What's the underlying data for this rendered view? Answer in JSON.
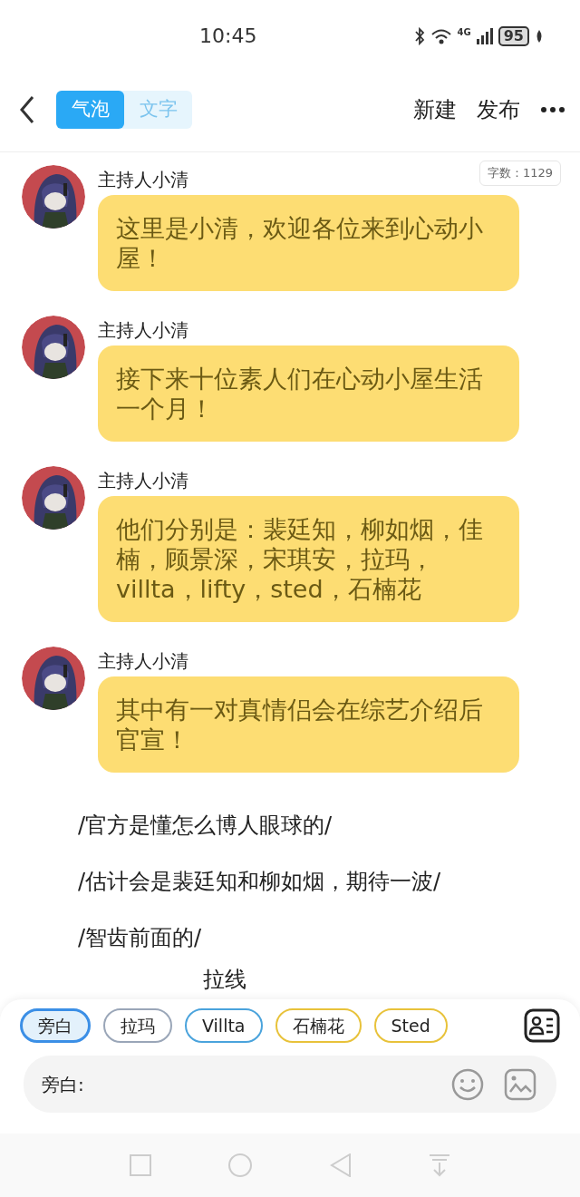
{
  "status_bar": {
    "time": "10:45",
    "network": "4G",
    "battery": "95"
  },
  "header": {
    "modes": [
      {
        "label": "气泡",
        "selected": true
      },
      {
        "label": "文字",
        "selected": false
      }
    ],
    "actions": [
      "新建",
      "发布"
    ]
  },
  "word_count": "字数：1129",
  "messages": [
    {
      "kind": "bubble",
      "speaker": "主持人小清",
      "text": "这里是小清，欢迎各位来到心动小屋！"
    },
    {
      "kind": "bubble",
      "speaker": "主持人小清",
      "text": "接下来十位素人们在心动小屋生活一个月！"
    },
    {
      "kind": "bubble",
      "speaker": "主持人小清",
      "text": "他们分别是：裴廷知，柳如烟，佳楠，顾景深，宋琪安，拉玛，villta，lifty，sted，石楠花"
    },
    {
      "kind": "bubble",
      "speaker": "主持人小清",
      "text": "其中有一对真情侣会在综艺介绍后官宣！"
    },
    {
      "kind": "narration",
      "text": "/官方是懂怎么博人眼球的/"
    },
    {
      "kind": "narration",
      "text": "/估计会是裴廷知和柳如烟，期待一波/"
    },
    {
      "kind": "narration",
      "text": "/智齿前面的/"
    },
    {
      "kind": "centered",
      "text": "拉线"
    }
  ],
  "roles": [
    {
      "label": "旁白",
      "selected": true,
      "color": "#3b8fe6"
    },
    {
      "label": "拉玛",
      "selected": false,
      "color": "#9aa6b8"
    },
    {
      "label": "Villta",
      "selected": false,
      "color": "#4aa3dc"
    },
    {
      "label": "石楠花",
      "selected": false,
      "color": "#e8c23a"
    },
    {
      "label": "Sted",
      "selected": false,
      "color": "#e8c23a"
    }
  ],
  "composer": {
    "prefix": "旁白:"
  }
}
